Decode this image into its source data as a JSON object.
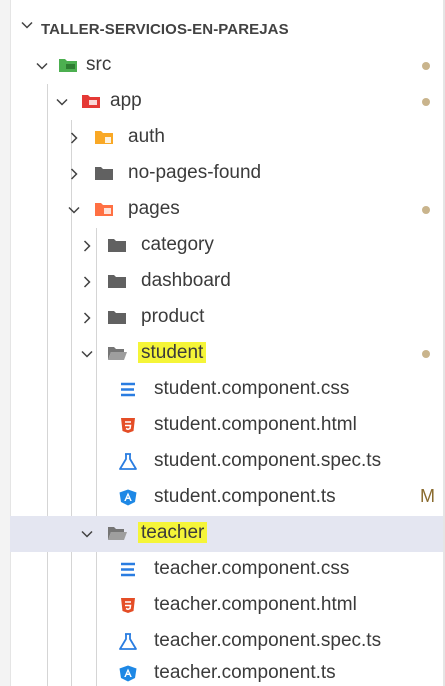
{
  "explorer": {
    "root_title": "TALLER-SERVICIOS-EN-PAREJAS"
  },
  "tree": [
    {
      "label": "src",
      "kind": "folder",
      "icon": "src-folder-icon",
      "expanded": true,
      "indicator": "dot"
    },
    {
      "label": "app",
      "kind": "folder",
      "icon": "app-folder-icon",
      "expanded": true,
      "indicator": "dot"
    },
    {
      "label": "auth",
      "kind": "folder",
      "icon": "auth-folder-icon",
      "expanded": false
    },
    {
      "label": "no-pages-found",
      "kind": "folder",
      "icon": "folder-icon",
      "expanded": false
    },
    {
      "label": "pages",
      "kind": "folder",
      "icon": "pages-folder-icon",
      "expanded": true,
      "indicator": "dot"
    },
    {
      "label": "category",
      "kind": "folder",
      "icon": "folder-icon",
      "expanded": false
    },
    {
      "label": "dashboard",
      "kind": "folder",
      "icon": "folder-icon",
      "expanded": false
    },
    {
      "label": "product",
      "kind": "folder",
      "icon": "folder-icon",
      "expanded": false
    },
    {
      "label": "student",
      "kind": "folder",
      "icon": "open-folder-icon",
      "expanded": true,
      "highlight": true,
      "indicator": "dot"
    },
    {
      "label": "student.component.css",
      "kind": "file",
      "icon": "css-file-icon"
    },
    {
      "label": "student.component.html",
      "kind": "file",
      "icon": "html-file-icon"
    },
    {
      "label": "student.component.spec.ts",
      "kind": "file",
      "icon": "test-flask-icon"
    },
    {
      "label": "student.component.ts",
      "kind": "file",
      "icon": "angular-component-icon",
      "badge": "M"
    },
    {
      "label": "teacher",
      "kind": "folder",
      "icon": "open-folder-icon",
      "expanded": true,
      "highlight": true,
      "selected": true
    },
    {
      "label": "teacher.component.css",
      "kind": "file",
      "icon": "css-file-icon"
    },
    {
      "label": "teacher.component.html",
      "kind": "file",
      "icon": "html-file-icon"
    },
    {
      "label": "teacher.component.spec.ts",
      "kind": "file",
      "icon": "test-flask-icon"
    },
    {
      "label": "teacher.component.ts",
      "kind": "file",
      "icon": "angular-component-icon"
    }
  ],
  "colors": {
    "selected_row": "#e4e6f1",
    "search_highlight": "#f5f538",
    "modified_badge": "#8a6b2e",
    "css_icon": "#2a7de1",
    "html_icon": "#e44d26",
    "test_icon": "#2a7de1",
    "angular_icon": "#1e88e5"
  }
}
